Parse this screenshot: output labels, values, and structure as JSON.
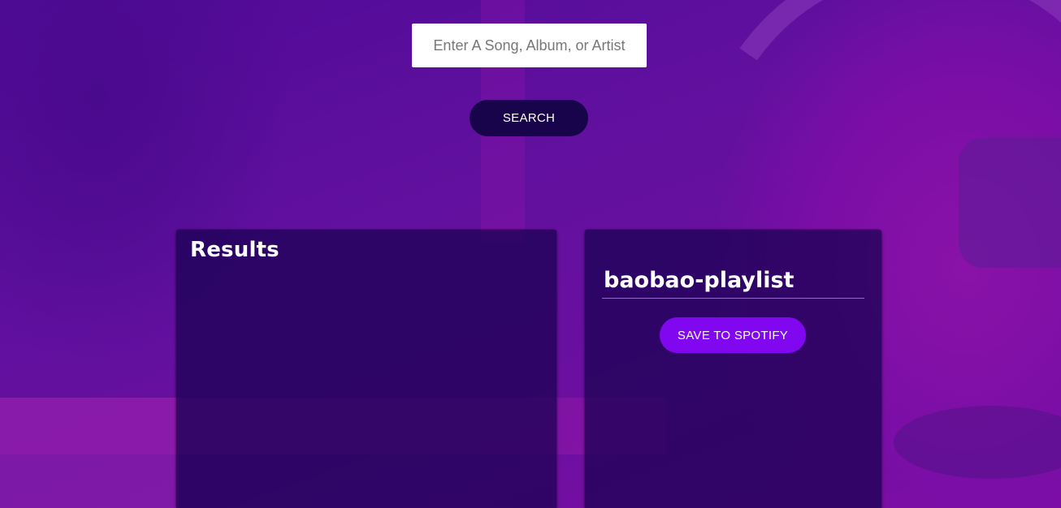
{
  "search": {
    "placeholder": "Enter A Song, Album, or Artist",
    "button_label": "SEARCH"
  },
  "results": {
    "title": "Results",
    "tracks": []
  },
  "playlist": {
    "name": "baobao-playlist",
    "save_label": "SAVE TO SPOTIFY",
    "tracks": []
  },
  "colors": {
    "background": "#5a0a9a",
    "search_button": "#18044a",
    "save_button": "#8107f0",
    "panel": "#180250"
  }
}
